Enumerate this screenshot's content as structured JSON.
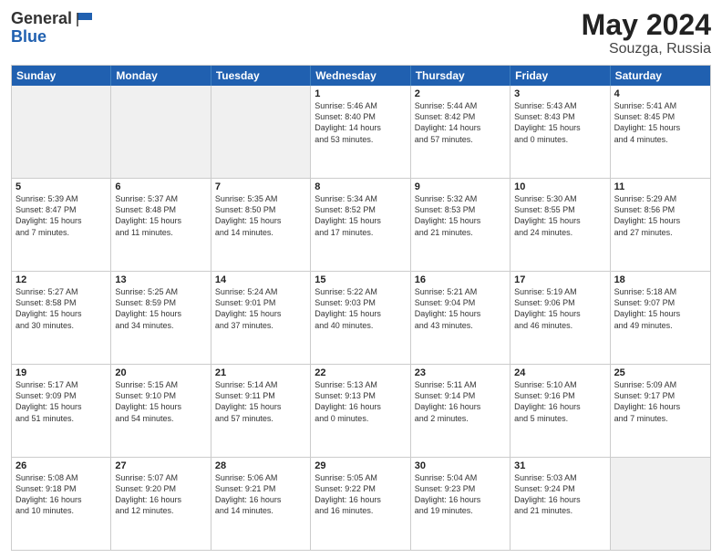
{
  "header": {
    "logo_general": "General",
    "logo_blue": "Blue",
    "title": "May 2024",
    "location": "Souzga, Russia"
  },
  "days_of_week": [
    "Sunday",
    "Monday",
    "Tuesday",
    "Wednesday",
    "Thursday",
    "Friday",
    "Saturday"
  ],
  "weeks": [
    [
      {
        "day": "",
        "info": "",
        "shaded": true
      },
      {
        "day": "",
        "info": "",
        "shaded": true
      },
      {
        "day": "",
        "info": "",
        "shaded": true
      },
      {
        "day": "1",
        "info": "Sunrise: 5:46 AM\nSunset: 8:40 PM\nDaylight: 14 hours\nand 53 minutes.",
        "shaded": false
      },
      {
        "day": "2",
        "info": "Sunrise: 5:44 AM\nSunset: 8:42 PM\nDaylight: 14 hours\nand 57 minutes.",
        "shaded": false
      },
      {
        "day": "3",
        "info": "Sunrise: 5:43 AM\nSunset: 8:43 PM\nDaylight: 15 hours\nand 0 minutes.",
        "shaded": false
      },
      {
        "day": "4",
        "info": "Sunrise: 5:41 AM\nSunset: 8:45 PM\nDaylight: 15 hours\nand 4 minutes.",
        "shaded": false
      }
    ],
    [
      {
        "day": "5",
        "info": "Sunrise: 5:39 AM\nSunset: 8:47 PM\nDaylight: 15 hours\nand 7 minutes.",
        "shaded": false
      },
      {
        "day": "6",
        "info": "Sunrise: 5:37 AM\nSunset: 8:48 PM\nDaylight: 15 hours\nand 11 minutes.",
        "shaded": false
      },
      {
        "day": "7",
        "info": "Sunrise: 5:35 AM\nSunset: 8:50 PM\nDaylight: 15 hours\nand 14 minutes.",
        "shaded": false
      },
      {
        "day": "8",
        "info": "Sunrise: 5:34 AM\nSunset: 8:52 PM\nDaylight: 15 hours\nand 17 minutes.",
        "shaded": false
      },
      {
        "day": "9",
        "info": "Sunrise: 5:32 AM\nSunset: 8:53 PM\nDaylight: 15 hours\nand 21 minutes.",
        "shaded": false
      },
      {
        "day": "10",
        "info": "Sunrise: 5:30 AM\nSunset: 8:55 PM\nDaylight: 15 hours\nand 24 minutes.",
        "shaded": false
      },
      {
        "day": "11",
        "info": "Sunrise: 5:29 AM\nSunset: 8:56 PM\nDaylight: 15 hours\nand 27 minutes.",
        "shaded": false
      }
    ],
    [
      {
        "day": "12",
        "info": "Sunrise: 5:27 AM\nSunset: 8:58 PM\nDaylight: 15 hours\nand 30 minutes.",
        "shaded": false
      },
      {
        "day": "13",
        "info": "Sunrise: 5:25 AM\nSunset: 8:59 PM\nDaylight: 15 hours\nand 34 minutes.",
        "shaded": false
      },
      {
        "day": "14",
        "info": "Sunrise: 5:24 AM\nSunset: 9:01 PM\nDaylight: 15 hours\nand 37 minutes.",
        "shaded": false
      },
      {
        "day": "15",
        "info": "Sunrise: 5:22 AM\nSunset: 9:03 PM\nDaylight: 15 hours\nand 40 minutes.",
        "shaded": false
      },
      {
        "day": "16",
        "info": "Sunrise: 5:21 AM\nSunset: 9:04 PM\nDaylight: 15 hours\nand 43 minutes.",
        "shaded": false
      },
      {
        "day": "17",
        "info": "Sunrise: 5:19 AM\nSunset: 9:06 PM\nDaylight: 15 hours\nand 46 minutes.",
        "shaded": false
      },
      {
        "day": "18",
        "info": "Sunrise: 5:18 AM\nSunset: 9:07 PM\nDaylight: 15 hours\nand 49 minutes.",
        "shaded": false
      }
    ],
    [
      {
        "day": "19",
        "info": "Sunrise: 5:17 AM\nSunset: 9:09 PM\nDaylight: 15 hours\nand 51 minutes.",
        "shaded": false
      },
      {
        "day": "20",
        "info": "Sunrise: 5:15 AM\nSunset: 9:10 PM\nDaylight: 15 hours\nand 54 minutes.",
        "shaded": false
      },
      {
        "day": "21",
        "info": "Sunrise: 5:14 AM\nSunset: 9:11 PM\nDaylight: 15 hours\nand 57 minutes.",
        "shaded": false
      },
      {
        "day": "22",
        "info": "Sunrise: 5:13 AM\nSunset: 9:13 PM\nDaylight: 16 hours\nand 0 minutes.",
        "shaded": false
      },
      {
        "day": "23",
        "info": "Sunrise: 5:11 AM\nSunset: 9:14 PM\nDaylight: 16 hours\nand 2 minutes.",
        "shaded": false
      },
      {
        "day": "24",
        "info": "Sunrise: 5:10 AM\nSunset: 9:16 PM\nDaylight: 16 hours\nand 5 minutes.",
        "shaded": false
      },
      {
        "day": "25",
        "info": "Sunrise: 5:09 AM\nSunset: 9:17 PM\nDaylight: 16 hours\nand 7 minutes.",
        "shaded": false
      }
    ],
    [
      {
        "day": "26",
        "info": "Sunrise: 5:08 AM\nSunset: 9:18 PM\nDaylight: 16 hours\nand 10 minutes.",
        "shaded": false
      },
      {
        "day": "27",
        "info": "Sunrise: 5:07 AM\nSunset: 9:20 PM\nDaylight: 16 hours\nand 12 minutes.",
        "shaded": false
      },
      {
        "day": "28",
        "info": "Sunrise: 5:06 AM\nSunset: 9:21 PM\nDaylight: 16 hours\nand 14 minutes.",
        "shaded": false
      },
      {
        "day": "29",
        "info": "Sunrise: 5:05 AM\nSunset: 9:22 PM\nDaylight: 16 hours\nand 16 minutes.",
        "shaded": false
      },
      {
        "day": "30",
        "info": "Sunrise: 5:04 AM\nSunset: 9:23 PM\nDaylight: 16 hours\nand 19 minutes.",
        "shaded": false
      },
      {
        "day": "31",
        "info": "Sunrise: 5:03 AM\nSunset: 9:24 PM\nDaylight: 16 hours\nand 21 minutes.",
        "shaded": false
      },
      {
        "day": "",
        "info": "",
        "shaded": true
      }
    ]
  ]
}
